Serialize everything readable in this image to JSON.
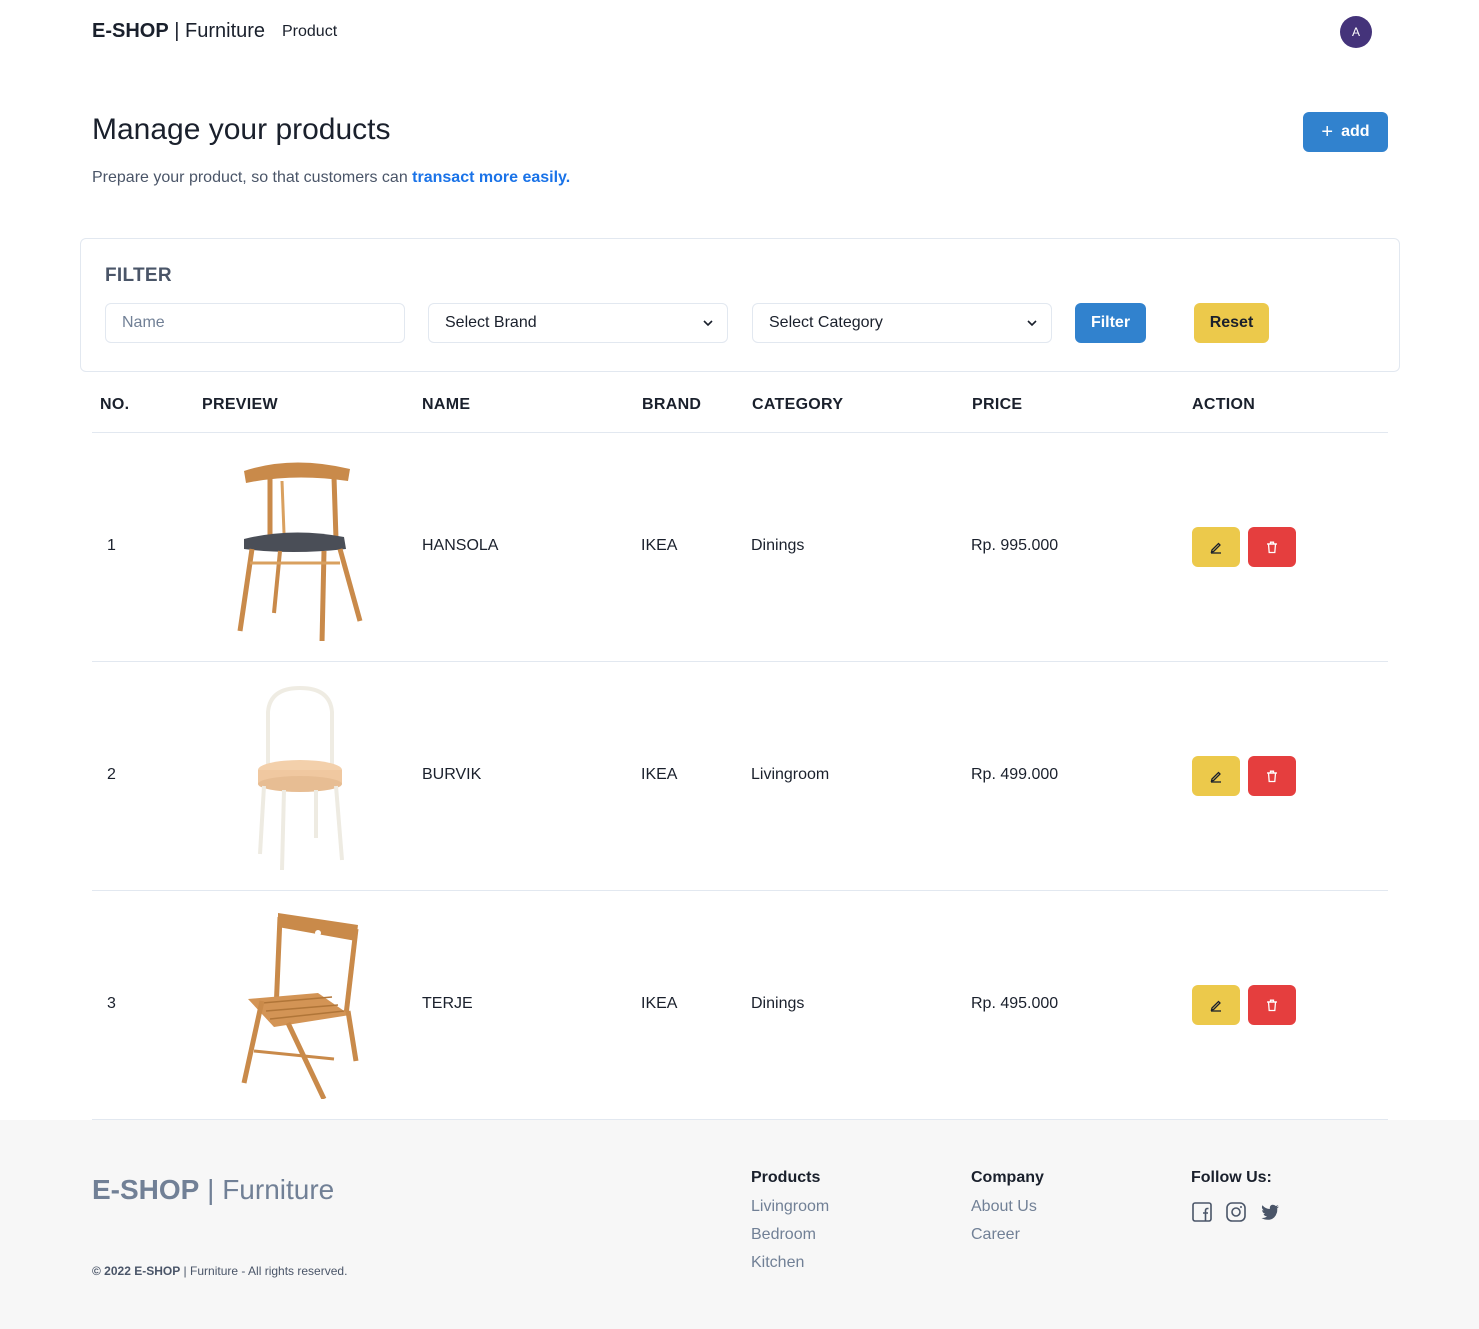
{
  "navbar": {
    "brand_bold": "E-SHOP",
    "brand_rest": "Furniture",
    "link": "Product",
    "avatar_initial": "A"
  },
  "header": {
    "title": "Manage your products",
    "subtitle_plain": "Prepare your product, so that customers can",
    "subtitle_link": "transact more easily.",
    "add_label": "add"
  },
  "filter": {
    "title": "FILTER",
    "name_placeholder": "Name",
    "brand_select": "Select Brand",
    "category_select": "Select Category",
    "filter_label": "Filter",
    "reset_label": "Reset"
  },
  "table": {
    "headers": [
      "NO.",
      "PREVIEW",
      "NAME",
      "BRAND",
      "CATEGORY",
      "PRICE",
      "ACTION"
    ],
    "rows": [
      {
        "no": "1",
        "name": "HANSOLA",
        "brand": "IKEA",
        "category": "Dinings",
        "price": "Rp. 995.000"
      },
      {
        "no": "2",
        "name": "BURVIK",
        "brand": "IKEA",
        "category": "Livingroom",
        "price": "Rp. 499.000"
      },
      {
        "no": "3",
        "name": "TERJE",
        "brand": "IKEA",
        "category": "Dinings",
        "price": "Rp. 495.000"
      }
    ]
  },
  "footer": {
    "brand_bold": "E-SHOP",
    "brand_rest": "Furniture",
    "copyright_prefix": "© 2022 E-SHOP",
    "copyright_rest": "Furniture - All rights reserved.",
    "products": {
      "title": "Products",
      "links": [
        "Livingroom",
        "Bedroom",
        "Kitchen"
      ]
    },
    "company": {
      "title": "Company",
      "links": [
        "About Us",
        "Career"
      ]
    },
    "follow": {
      "title": "Follow Us:",
      "icons": [
        "facebook-icon",
        "instagram-icon",
        "twitter-icon"
      ]
    }
  },
  "colors": {
    "primary": "#3182ce",
    "warning": "#ecc94b",
    "danger": "#e53e3e",
    "avatar": "#44337a",
    "link": "#1a73e8"
  }
}
